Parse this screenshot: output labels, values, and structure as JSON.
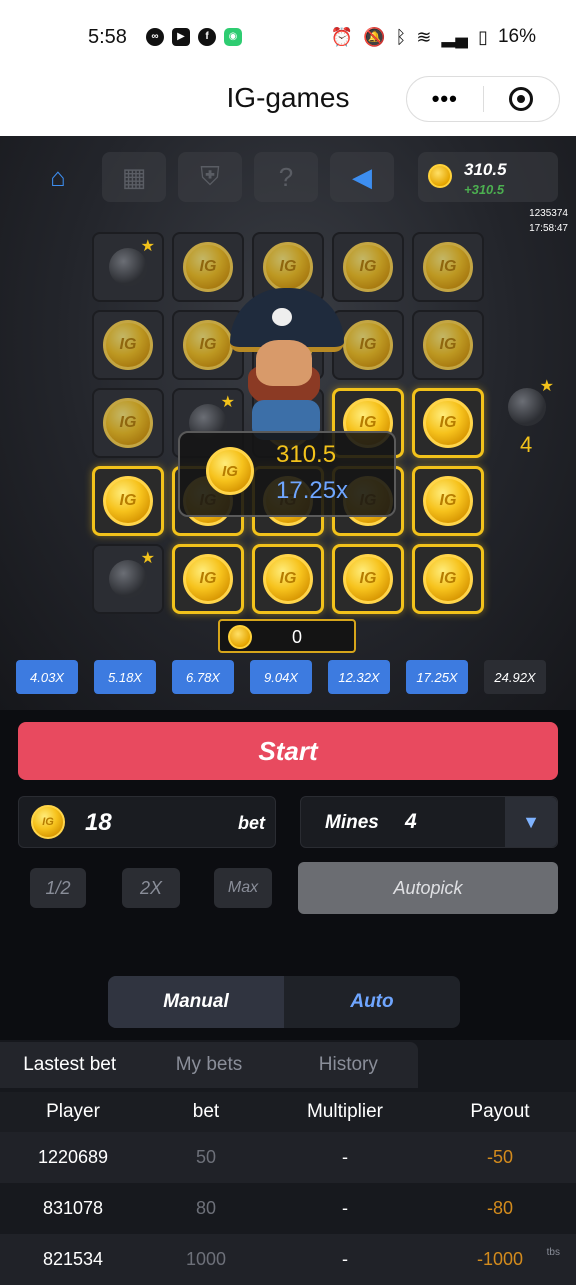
{
  "status_bar": {
    "time": "5:58",
    "battery": "16%"
  },
  "titlebar": {
    "title": "IG-games",
    "menu_label": "•••"
  },
  "balance": {
    "value": "310.5",
    "delta": "+310.5"
  },
  "meta": {
    "user_id": "1235374",
    "clock": "17:58:47"
  },
  "coin_label": "IG",
  "grid": [
    [
      "bomb",
      "coin",
      "coin",
      "coin",
      "coin"
    ],
    [
      "coin",
      "coin",
      "coin",
      "coin",
      "coin"
    ],
    [
      "coin",
      "bomb",
      "coin",
      "coin-revealed",
      "coin-revealed"
    ],
    [
      "coin-revealed",
      "coin-revealed",
      "coin-revealed",
      "coin-revealed",
      "coin-revealed"
    ],
    [
      "bomb",
      "coin-revealed",
      "coin-revealed",
      "coin-revealed",
      "coin-revealed"
    ]
  ],
  "win": {
    "amount": "310.5",
    "multiplier": "17.25x"
  },
  "mines_remaining": "4",
  "pending_win": "0",
  "multipliers": [
    {
      "label": "4.03X",
      "state": "hit"
    },
    {
      "label": "5.18X",
      "state": "hit"
    },
    {
      "label": "6.78X",
      "state": "hit"
    },
    {
      "label": "9.04X",
      "state": "hit"
    },
    {
      "label": "12.32X",
      "state": "hit"
    },
    {
      "label": "17.25X",
      "state": "hit"
    },
    {
      "label": "24.92X",
      "state": "next"
    }
  ],
  "controls": {
    "start_label": "Start",
    "bet_value": "18",
    "bet_label": "bet",
    "mines_label": "Mines",
    "mines_value": "4",
    "half_label": "1/2",
    "double_label": "2X",
    "max_label": "Max",
    "autopick_label": "Autopick",
    "mode_manual": "Manual",
    "mode_auto": "Auto"
  },
  "records": {
    "tabs": [
      "Lastest bet",
      "My bets",
      "History"
    ],
    "headers": [
      "Player",
      "bet",
      "Multiplier",
      "Payout"
    ],
    "rows": [
      [
        "1220689",
        "50",
        "-",
        "-50"
      ],
      [
        "831078",
        "80",
        "-",
        "-80"
      ],
      [
        "821534",
        "1000",
        "-",
        "-1000"
      ]
    ]
  },
  "watermark": "tbs",
  "colors": {
    "accent_blue": "#3d7be0",
    "start_red": "#e84a5f",
    "gold": "#f2c21b",
    "payout": "#d38b1d"
  }
}
